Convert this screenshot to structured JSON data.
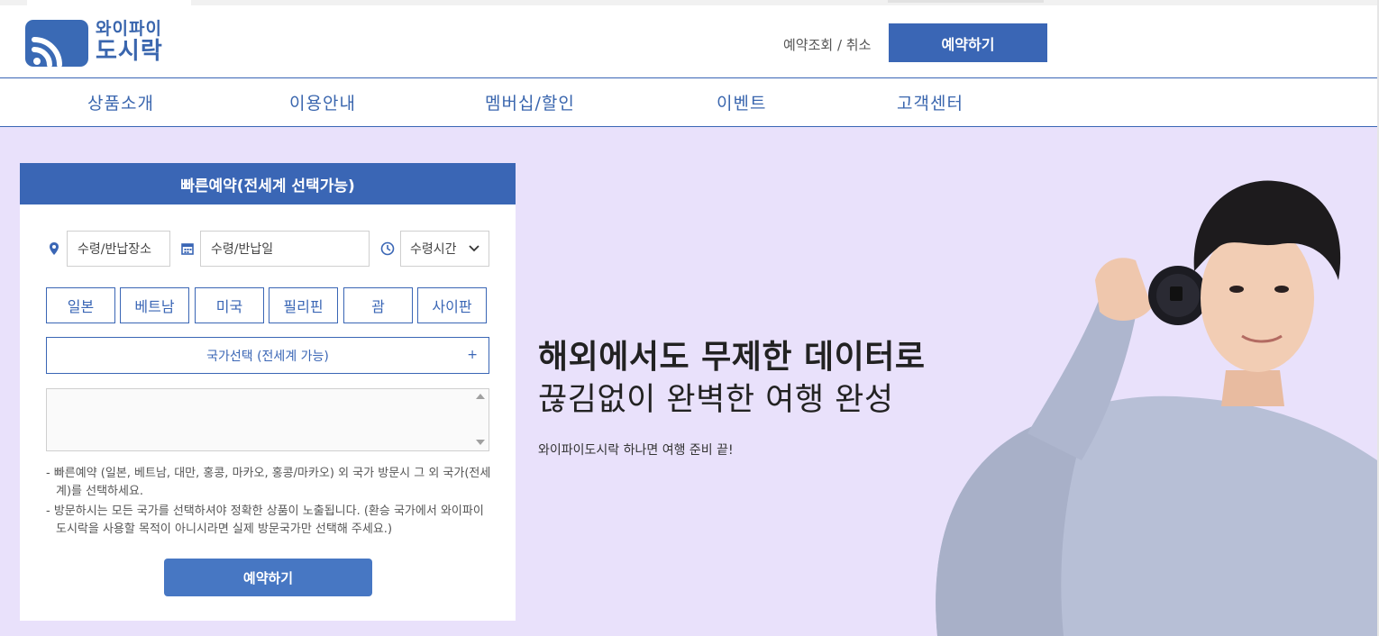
{
  "brand": {
    "name_line1": "와이파이",
    "name_line2": "도시락",
    "color": "#3a66b5"
  },
  "header": {
    "lookup_label": "예약조회 / 취소",
    "reserve_label": "예약하기"
  },
  "nav": {
    "items": [
      {
        "label": "상품소개"
      },
      {
        "label": "이용안내"
      },
      {
        "label": "멤버십/할인"
      },
      {
        "label": "이벤트"
      },
      {
        "label": "고객센터"
      }
    ]
  },
  "quick": {
    "title": "빠른예약(전세계 선택가능)",
    "place_placeholder": "수령/반납장소",
    "date_placeholder": "수령/반납일",
    "time_selected": "수령시간",
    "countries": [
      "일본",
      "베트남",
      "미국",
      "필리핀",
      "괌",
      "사이판"
    ],
    "world_select_label": "국가선택 (전세계 가능)",
    "world_select_plus": "+",
    "notes": [
      "- 빠른예약 (일본, 베트남, 대만, 홍콩, 마카오, 홍콩/마카오) 외 국가 방문시 그 외 국가(전세계)를 선택하세요.",
      "- 방문하시는 모든 국가를 선택하셔야 정확한 상품이 노출됩니다. (환승 국가에서 와이파이도시락을 사용할 목적이 아니시라면 실제 방문국가만 선택해 주세요.)"
    ],
    "submit_label": "예약하기"
  },
  "hero": {
    "title": "해외에서도 무제한 데이터로",
    "subtitle": "끊김없이 완벽한 여행 완성",
    "tagline": "와이파이도시락 하나면 여행 준비 끝!",
    "background": "#e9e1fb"
  },
  "icons": {
    "logo": "wifi-signal-icon",
    "place": "map-pin-icon",
    "date": "calendar-icon",
    "time": "clock-icon",
    "select": "chevron-down-icon"
  }
}
